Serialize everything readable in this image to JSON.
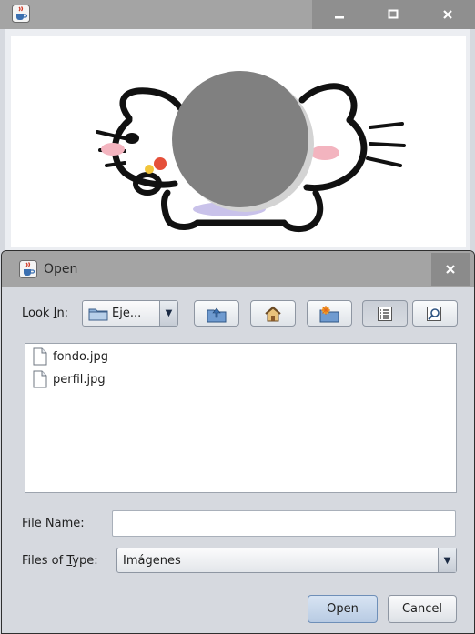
{
  "main_window": {
    "icons": {
      "app": "java-cup-icon",
      "minimize": "minimize-icon",
      "maximize": "maximize-icon",
      "close": "close-icon"
    },
    "canvas": {
      "image": "kitty-drawing-with-gray-circle"
    }
  },
  "dialog": {
    "title": "Open",
    "look_in": {
      "label_pre": "Look ",
      "label_mn": "I",
      "label_post": "n:",
      "value": "Eje..."
    },
    "toolbar_icons": [
      "up-folder-icon",
      "home-icon",
      "new-folder-icon",
      "list-view-icon",
      "details-view-icon"
    ],
    "files": [
      {
        "name": "fondo.jpg"
      },
      {
        "name": "perfil.jpg"
      }
    ],
    "file_name": {
      "label_pre": "File ",
      "label_mn": "N",
      "label_post": "ame:",
      "value": ""
    },
    "file_type": {
      "label_pre": "Files of ",
      "label_mn": "T",
      "label_post": "ype:",
      "value": "Imágenes"
    },
    "buttons": {
      "open": "Open",
      "cancel": "Cancel"
    }
  },
  "colors": {
    "titlebar": "#a4a4a4",
    "titlebar_button": "#8f8f8f",
    "dialog_bg": "#d6d9df",
    "accent": "#6e8fb8"
  }
}
